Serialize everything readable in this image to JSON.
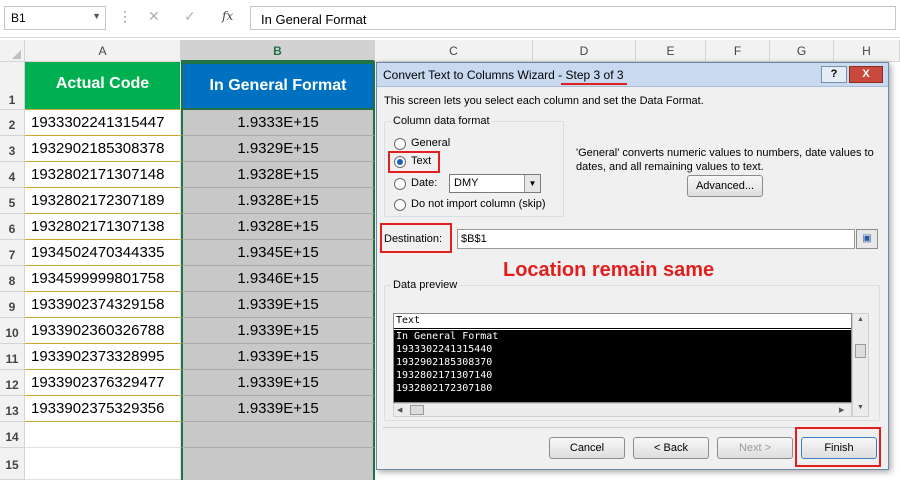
{
  "formula_bar": {
    "name_box": "B1",
    "formula": "In General Format",
    "icons": [
      "cancel-icon",
      "enter-icon",
      "function-icon"
    ],
    "fx_label": "fx"
  },
  "columns": [
    "A",
    "B",
    "C",
    "D",
    "E",
    "F",
    "G",
    "H"
  ],
  "selected_column": "B",
  "rows": [
    "1",
    "2",
    "3",
    "4",
    "5",
    "6",
    "7",
    "8",
    "9",
    "10",
    "11",
    "12",
    "13",
    "14",
    "15"
  ],
  "sheet": {
    "header_a": "Actual Code",
    "header_b": "In General Format",
    "header_a_color": "#00b050",
    "header_b_color": "#0070c0",
    "col_a": [
      "1933302241315447",
      "1932902185308378",
      "1932802171307148",
      "1932802172307189",
      "1932802171307138",
      "1934502470344335",
      "1934599999801758",
      "1933902374329158",
      "1933902360326788",
      "1933902373328995",
      "1933902376329477",
      "1933902375329356"
    ],
    "col_b": [
      "1.9333E+15",
      "1.9329E+15",
      "1.9328E+15",
      "1.9328E+15",
      "1.9328E+15",
      "1.9345E+15",
      "1.9346E+15",
      "1.9339E+15",
      "1.9339E+15",
      "1.9339E+15",
      "1.9339E+15",
      "1.9339E+15"
    ]
  },
  "dialog": {
    "title": "Convert Text to Columns Wizard - ",
    "step": "Step 3 of 3",
    "help_button": "?",
    "close_button": "X",
    "description": "This screen lets you select each column and set the Data Format.",
    "group_label": "Column data format",
    "radio_general": "General",
    "radio_text": "Text",
    "radio_date": "Date:",
    "radio_skip": "Do not import column (skip)",
    "date_value": "DMY",
    "selected_format": "Text",
    "info": "'General' converts numeric values to numbers, date values to dates, and all remaining values to text.",
    "advanced_button": "Advanced...",
    "destination_label": "Destination:",
    "destination_value": "$B$1",
    "annotation": "Location remain same",
    "preview_label": "Data preview",
    "preview_header": "Text",
    "preview_lines": [
      "In General Format",
      "1933302241315440",
      "1932902185308370",
      "1932802171307140",
      "1932802172307180"
    ],
    "cancel_button": "Cancel",
    "back_button": "< Back",
    "next_button": "Next >",
    "finish_button": "Finish",
    "accent_red": "#e0201f"
  }
}
